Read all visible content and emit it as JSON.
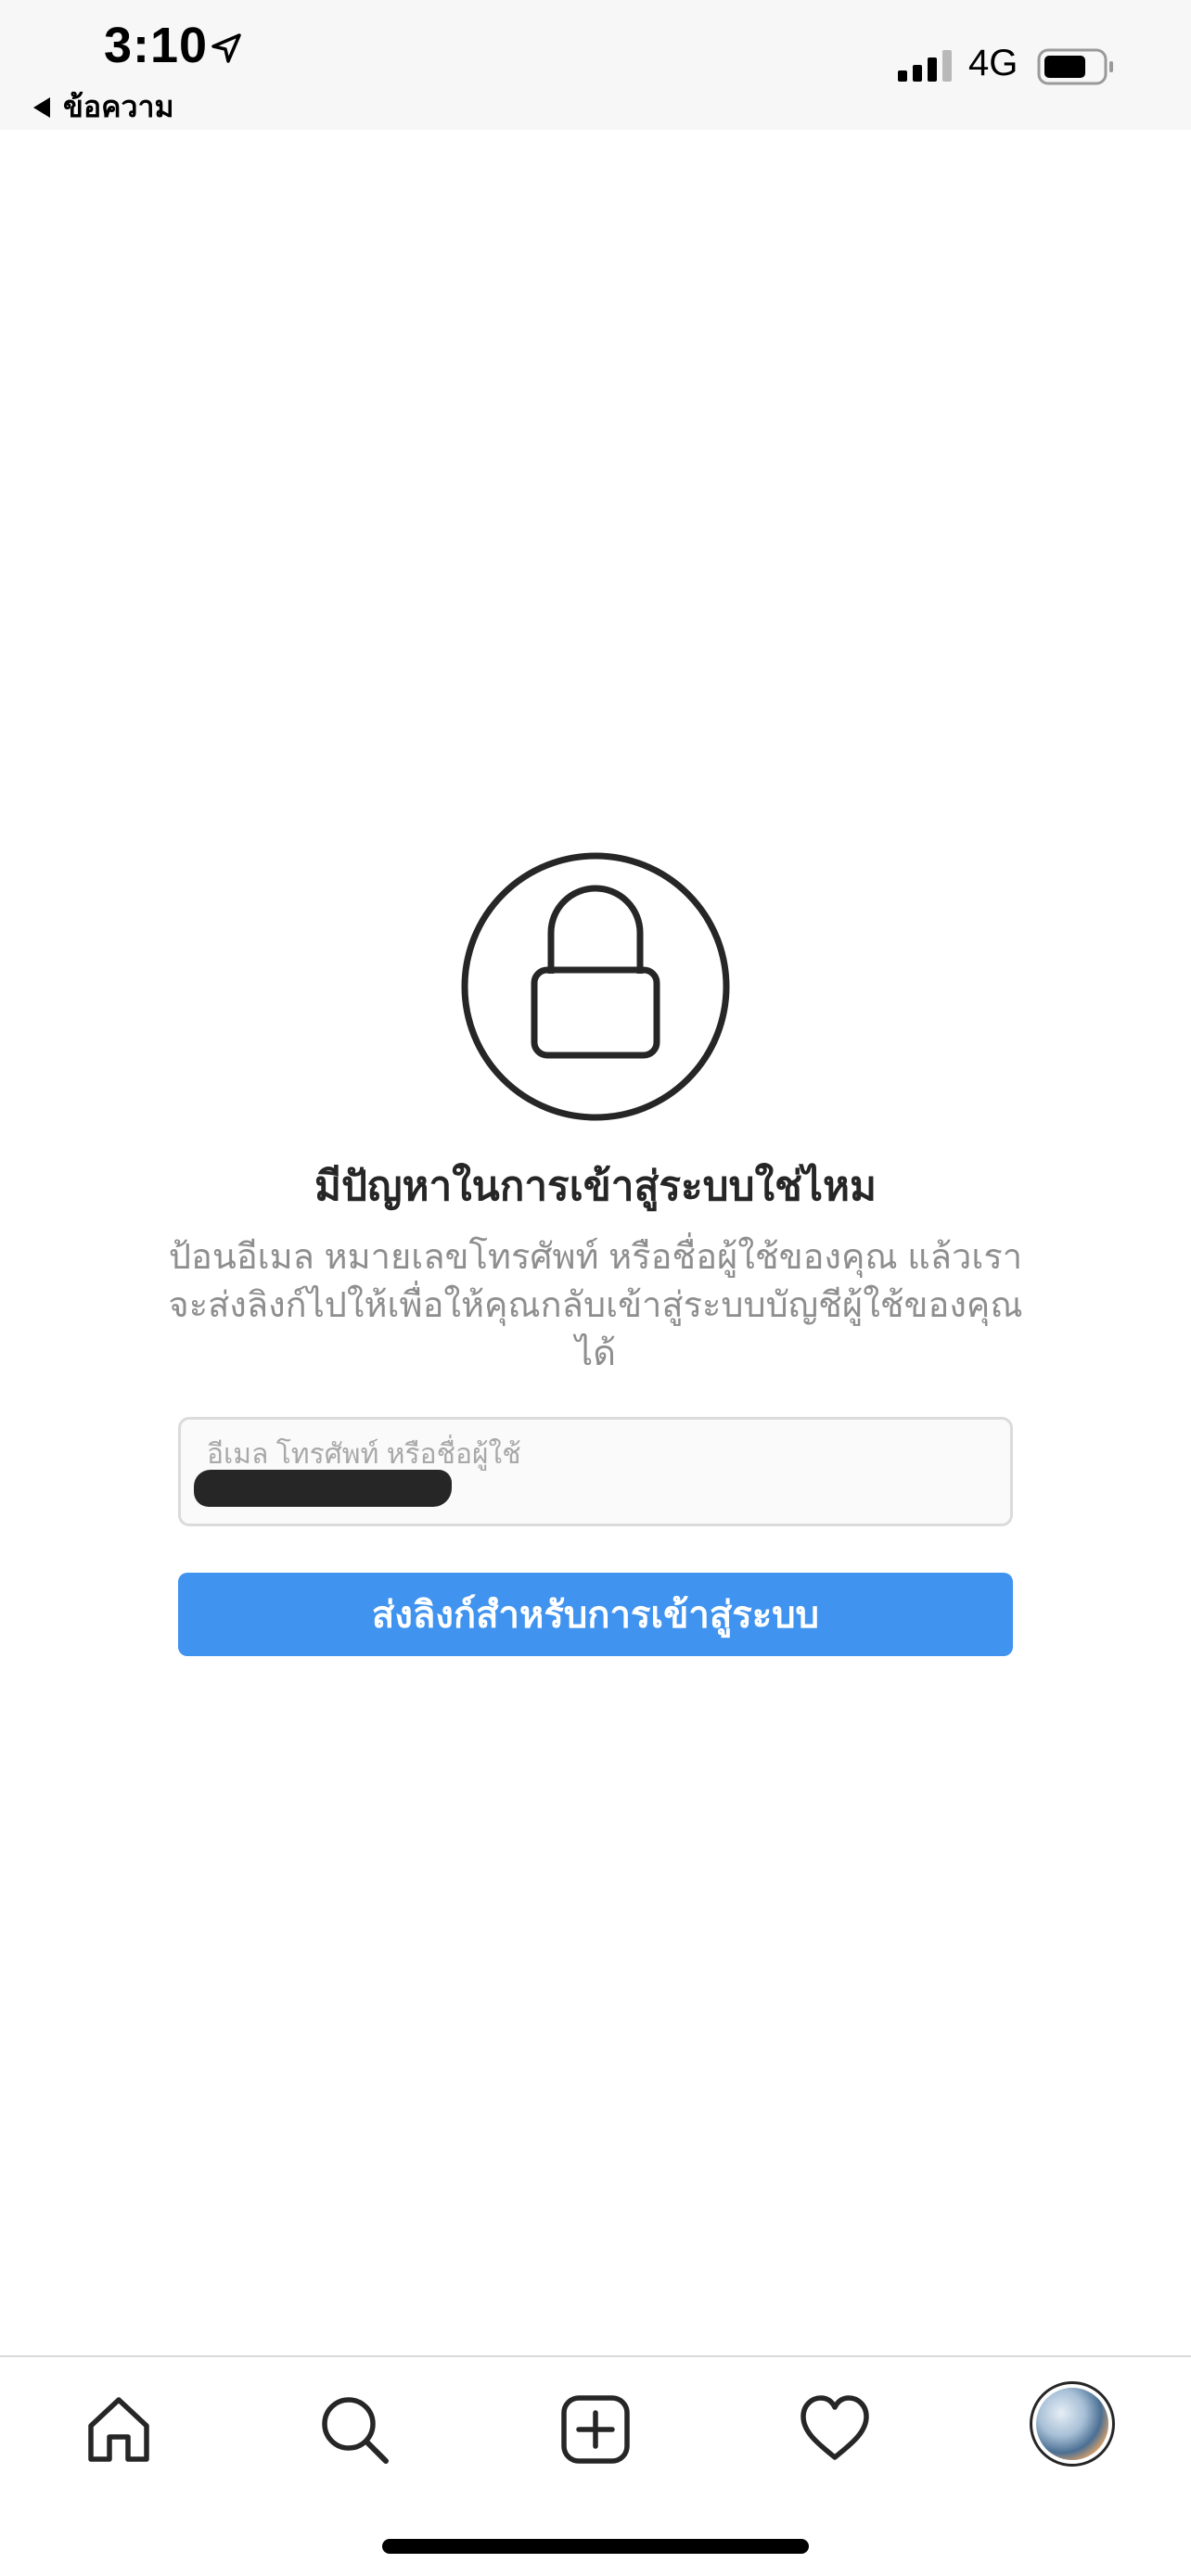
{
  "status_bar": {
    "time": "3:10",
    "network": "4G",
    "back_label": "ข้อความ"
  },
  "main": {
    "title": "มีปัญหาในการเข้าสู่ระบบใช่ไหม",
    "subtitle": "ป้อนอีเมล หมายเลขโทรศัพท์ หรือชื่อผู้ใช้ของคุณ แล้วเราจะส่งลิงก์ไปให้เพื่อให้คุณกลับเข้าสู่ระบบบัญชีผู้ใช้ของคุณได้",
    "input_label": "อีเมล โทรศัพท์ หรือชื่อผู้ใช้",
    "submit_label": "ส่งลิงก์สำหรับการเข้าสู่ระบบ"
  },
  "tab_bar": {
    "tabs": [
      "home-icon",
      "search-icon",
      "new-post-icon",
      "activity-heart-icon",
      "profile-avatar"
    ]
  },
  "colors": {
    "accent": "#4093ef",
    "text_primary": "#262626",
    "text_secondary": "#8e8e8e",
    "border": "#dbdbdb"
  }
}
